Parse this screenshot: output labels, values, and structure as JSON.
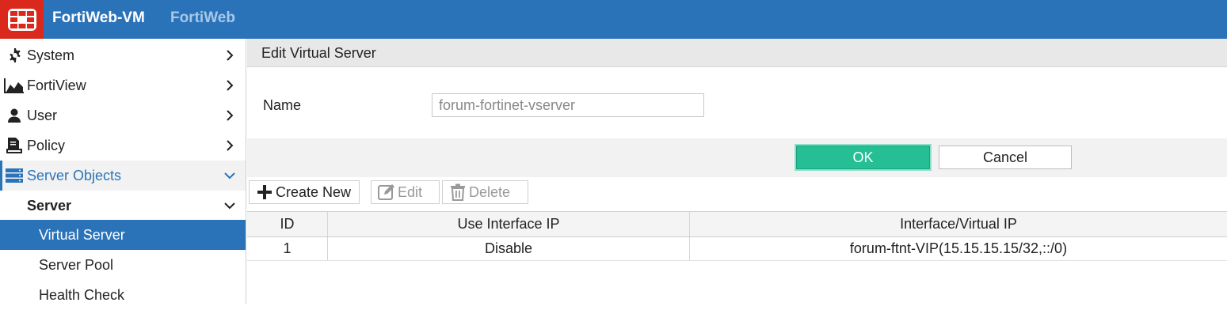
{
  "header": {
    "brand": "FortiWeb-VM",
    "product": "FortiWeb",
    "logo_icon": "fortinet-logo-icon",
    "colors": {
      "bar": "#2b73b9",
      "logo_bg": "#da291c"
    }
  },
  "sidebar": {
    "items": [
      {
        "label": "System",
        "icon": "gear-icon"
      },
      {
        "label": "FortiView",
        "icon": "area-chart-icon"
      },
      {
        "label": "User",
        "icon": "user-icon"
      },
      {
        "label": "Policy",
        "icon": "policy-icon"
      },
      {
        "label": "Server Objects",
        "icon": "server-icon"
      },
      {
        "label": "Server"
      },
      {
        "label": "Virtual Server"
      },
      {
        "label": "Server Pool"
      },
      {
        "label": "Health Check"
      }
    ],
    "active": "Virtual Server"
  },
  "form": {
    "title": "Edit Virtual Server",
    "name_label": "Name",
    "name_value": "forum-fortinet-vserver",
    "ok_label": "OK",
    "cancel_label": "Cancel",
    "ok_color": "#26bf95"
  },
  "toolbar": {
    "create_label": "Create New",
    "edit_label": "Edit",
    "delete_label": "Delete"
  },
  "table": {
    "columns": [
      "ID",
      "Use Interface IP",
      "Interface/Virtual IP"
    ],
    "rows": [
      [
        "1",
        "Disable",
        "forum-ftnt-VIP(15.15.15.15/32,::/0)"
      ]
    ]
  }
}
